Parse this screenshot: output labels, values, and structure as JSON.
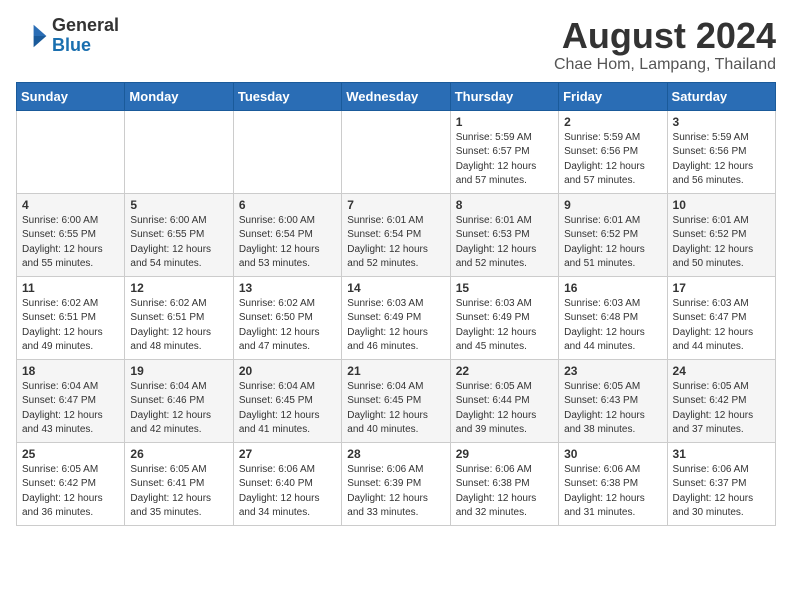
{
  "header": {
    "logo_general": "General",
    "logo_blue": "Blue",
    "main_title": "August 2024",
    "subtitle": "Chae Hom, Lampang, Thailand"
  },
  "calendar": {
    "days_of_week": [
      "Sunday",
      "Monday",
      "Tuesday",
      "Wednesday",
      "Thursday",
      "Friday",
      "Saturday"
    ],
    "weeks": [
      [
        {
          "day": "",
          "info": ""
        },
        {
          "day": "",
          "info": ""
        },
        {
          "day": "",
          "info": ""
        },
        {
          "day": "",
          "info": ""
        },
        {
          "day": "1",
          "info": "Sunrise: 5:59 AM\nSunset: 6:57 PM\nDaylight: 12 hours\nand 57 minutes."
        },
        {
          "day": "2",
          "info": "Sunrise: 5:59 AM\nSunset: 6:56 PM\nDaylight: 12 hours\nand 57 minutes."
        },
        {
          "day": "3",
          "info": "Sunrise: 5:59 AM\nSunset: 6:56 PM\nDaylight: 12 hours\nand 56 minutes."
        }
      ],
      [
        {
          "day": "4",
          "info": "Sunrise: 6:00 AM\nSunset: 6:55 PM\nDaylight: 12 hours\nand 55 minutes."
        },
        {
          "day": "5",
          "info": "Sunrise: 6:00 AM\nSunset: 6:55 PM\nDaylight: 12 hours\nand 54 minutes."
        },
        {
          "day": "6",
          "info": "Sunrise: 6:00 AM\nSunset: 6:54 PM\nDaylight: 12 hours\nand 53 minutes."
        },
        {
          "day": "7",
          "info": "Sunrise: 6:01 AM\nSunset: 6:54 PM\nDaylight: 12 hours\nand 52 minutes."
        },
        {
          "day": "8",
          "info": "Sunrise: 6:01 AM\nSunset: 6:53 PM\nDaylight: 12 hours\nand 52 minutes."
        },
        {
          "day": "9",
          "info": "Sunrise: 6:01 AM\nSunset: 6:52 PM\nDaylight: 12 hours\nand 51 minutes."
        },
        {
          "day": "10",
          "info": "Sunrise: 6:01 AM\nSunset: 6:52 PM\nDaylight: 12 hours\nand 50 minutes."
        }
      ],
      [
        {
          "day": "11",
          "info": "Sunrise: 6:02 AM\nSunset: 6:51 PM\nDaylight: 12 hours\nand 49 minutes."
        },
        {
          "day": "12",
          "info": "Sunrise: 6:02 AM\nSunset: 6:51 PM\nDaylight: 12 hours\nand 48 minutes."
        },
        {
          "day": "13",
          "info": "Sunrise: 6:02 AM\nSunset: 6:50 PM\nDaylight: 12 hours\nand 47 minutes."
        },
        {
          "day": "14",
          "info": "Sunrise: 6:03 AM\nSunset: 6:49 PM\nDaylight: 12 hours\nand 46 minutes."
        },
        {
          "day": "15",
          "info": "Sunrise: 6:03 AM\nSunset: 6:49 PM\nDaylight: 12 hours\nand 45 minutes."
        },
        {
          "day": "16",
          "info": "Sunrise: 6:03 AM\nSunset: 6:48 PM\nDaylight: 12 hours\nand 44 minutes."
        },
        {
          "day": "17",
          "info": "Sunrise: 6:03 AM\nSunset: 6:47 PM\nDaylight: 12 hours\nand 44 minutes."
        }
      ],
      [
        {
          "day": "18",
          "info": "Sunrise: 6:04 AM\nSunset: 6:47 PM\nDaylight: 12 hours\nand 43 minutes."
        },
        {
          "day": "19",
          "info": "Sunrise: 6:04 AM\nSunset: 6:46 PM\nDaylight: 12 hours\nand 42 minutes."
        },
        {
          "day": "20",
          "info": "Sunrise: 6:04 AM\nSunset: 6:45 PM\nDaylight: 12 hours\nand 41 minutes."
        },
        {
          "day": "21",
          "info": "Sunrise: 6:04 AM\nSunset: 6:45 PM\nDaylight: 12 hours\nand 40 minutes."
        },
        {
          "day": "22",
          "info": "Sunrise: 6:05 AM\nSunset: 6:44 PM\nDaylight: 12 hours\nand 39 minutes."
        },
        {
          "day": "23",
          "info": "Sunrise: 6:05 AM\nSunset: 6:43 PM\nDaylight: 12 hours\nand 38 minutes."
        },
        {
          "day": "24",
          "info": "Sunrise: 6:05 AM\nSunset: 6:42 PM\nDaylight: 12 hours\nand 37 minutes."
        }
      ],
      [
        {
          "day": "25",
          "info": "Sunrise: 6:05 AM\nSunset: 6:42 PM\nDaylight: 12 hours\nand 36 minutes."
        },
        {
          "day": "26",
          "info": "Sunrise: 6:05 AM\nSunset: 6:41 PM\nDaylight: 12 hours\nand 35 minutes."
        },
        {
          "day": "27",
          "info": "Sunrise: 6:06 AM\nSunset: 6:40 PM\nDaylight: 12 hours\nand 34 minutes."
        },
        {
          "day": "28",
          "info": "Sunrise: 6:06 AM\nSunset: 6:39 PM\nDaylight: 12 hours\nand 33 minutes."
        },
        {
          "day": "29",
          "info": "Sunrise: 6:06 AM\nSunset: 6:38 PM\nDaylight: 12 hours\nand 32 minutes."
        },
        {
          "day": "30",
          "info": "Sunrise: 6:06 AM\nSunset: 6:38 PM\nDaylight: 12 hours\nand 31 minutes."
        },
        {
          "day": "31",
          "info": "Sunrise: 6:06 AM\nSunset: 6:37 PM\nDaylight: 12 hours\nand 30 minutes."
        }
      ]
    ]
  }
}
